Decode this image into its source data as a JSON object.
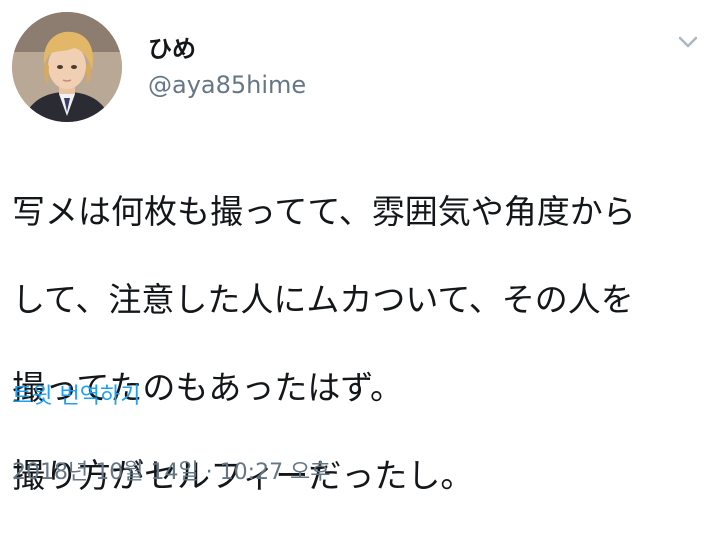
{
  "author": {
    "display_name": "ひめ",
    "handle": "@aya85hime"
  },
  "tweet": {
    "text_lines": [
      "写メは何枚も撮ってて、雰囲気や角度から",
      "して、注意した人にムカついて、その人を",
      "撮ってたのもあったはず。",
      "撮り方がセルフィーだったし。"
    ],
    "translate_label": "트윗 번역하기",
    "timestamp": "2018년 10월 14일 · 10:27 오후"
  },
  "icons": {
    "menu": "chevron-down-icon",
    "avatar": "profile-photo"
  },
  "colors": {
    "text": "#14171a",
    "secondary": "#657786",
    "link": "#1da1f2",
    "caret": "#aab8c2"
  }
}
